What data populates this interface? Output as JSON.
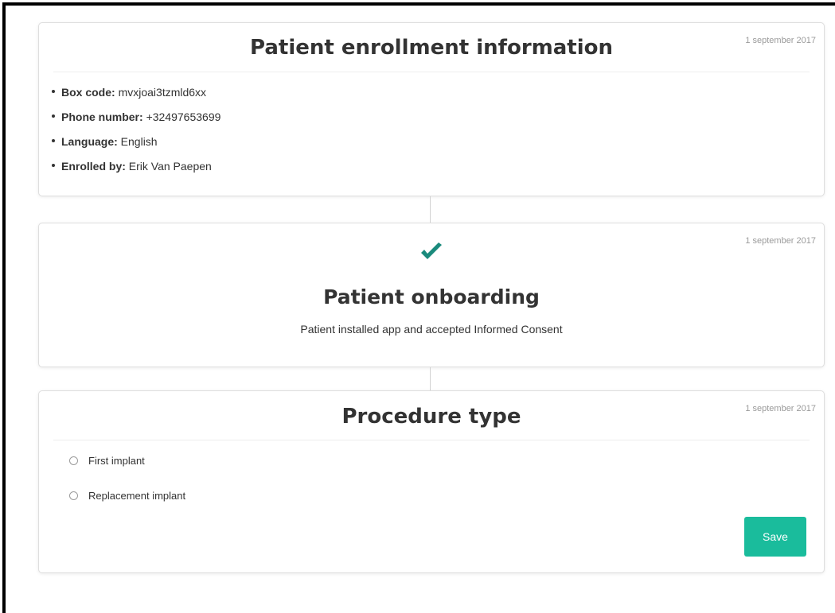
{
  "colors": {
    "accent": "#1abc9c",
    "check": "#1a8a7c",
    "date_text": "#9a9a9a",
    "card_border": "#dedede"
  },
  "enrollment": {
    "title": "Patient enrollment information",
    "date": "1 september 2017",
    "fields": [
      {
        "label": "Box code:",
        "value": "mvxjoai3tzmld6xx"
      },
      {
        "label": "Phone number:",
        "value": "+32497653699"
      },
      {
        "label": "Language:",
        "value": "English"
      },
      {
        "label": "Enrolled by:",
        "value": "Erik Van Paepen"
      }
    ]
  },
  "onboarding": {
    "icon": "checkmark-icon",
    "title": "Patient onboarding",
    "date": "1 september 2017",
    "description": "Patient installed app and accepted Informed Consent"
  },
  "procedure": {
    "title": "Procedure type",
    "date": "1 september 2017",
    "options": [
      {
        "label": "First implant",
        "selected": false
      },
      {
        "label": "Replacement implant",
        "selected": false
      }
    ],
    "save_label": "Save"
  }
}
